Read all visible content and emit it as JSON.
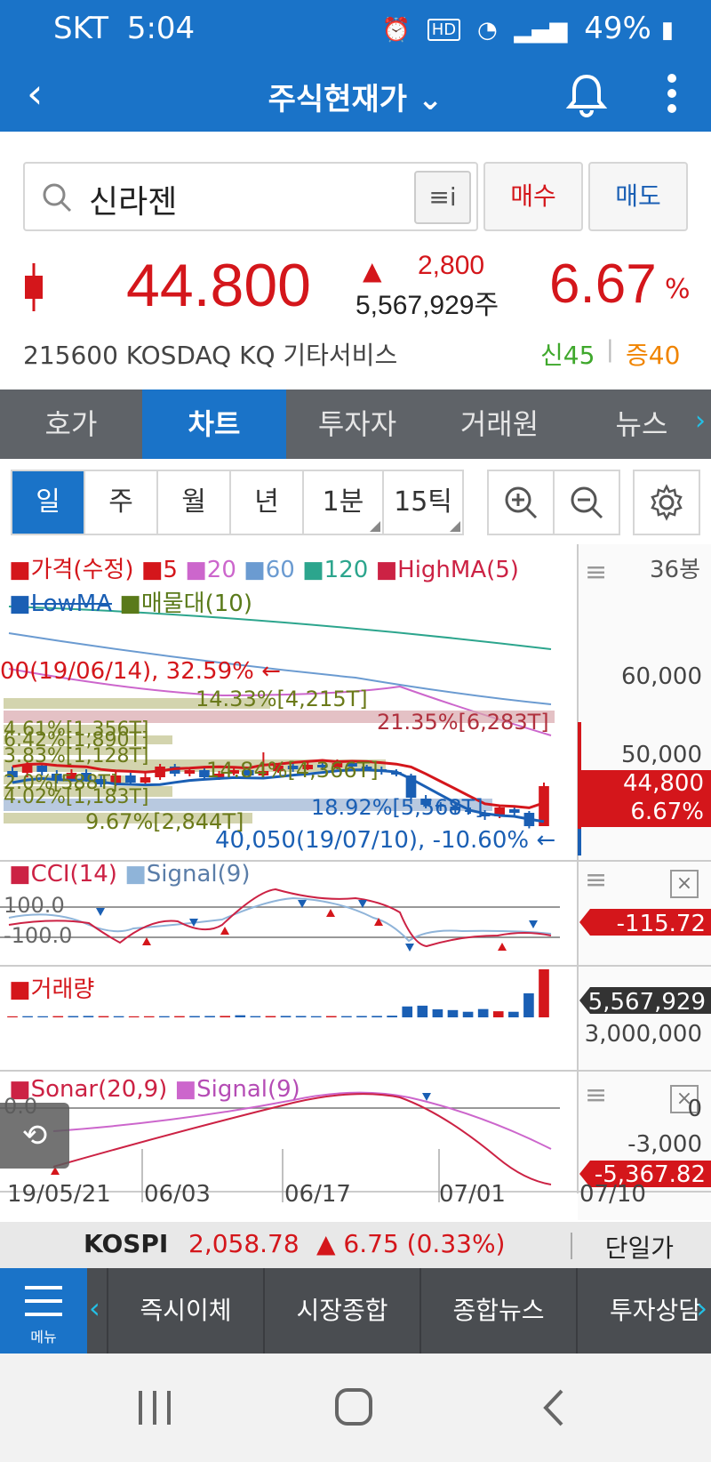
{
  "status": {
    "carrier": "SKT",
    "time": "5:04",
    "battery": "49%",
    "hd_label": "HD"
  },
  "app": {
    "title": "주식현재가 ⌄"
  },
  "search": {
    "value": "신라젠",
    "filter_icon": "≡i"
  },
  "actions": {
    "buy": "매수",
    "sell": "매도"
  },
  "quote": {
    "price": "44.800",
    "change_arrow": "▲",
    "change": "2,800",
    "volume": "5,567,929주",
    "percent": "6.67",
    "percent_sign": "%",
    "code_info": "215600  KOSDAQ  KQ 기타서비스",
    "badge_new": "신45",
    "badge_sep": "|",
    "badge_inc": "증40"
  },
  "tabs": [
    {
      "label": "호가"
    },
    {
      "label": "차트"
    },
    {
      "label": "투자자"
    },
    {
      "label": "거래원"
    },
    {
      "label": "뉴스"
    }
  ],
  "periods": [
    {
      "label": "일"
    },
    {
      "label": "주"
    },
    {
      "label": "월"
    },
    {
      "label": "년"
    },
    {
      "label": "1분"
    },
    {
      "label": "15틱"
    }
  ],
  "chart_legend": {
    "price": "가격(수정)",
    "ma5": "5",
    "ma20": "20",
    "ma60": "60",
    "ma120": "120",
    "highma": "HighMA(5)",
    "lowma": "LowMA",
    "volprofile": "매물대(10)",
    "bars_count": "36봉",
    "cci": "CCI(14)",
    "cci_signal": "Signal(9)",
    "volume": "거래량",
    "sonar": "Sonar(20,9)",
    "sonar_signal": "Signal(9)"
  },
  "chart_annotations": {
    "high_note": "00(19/06/14), 32.59% ←",
    "low_note": "40,050(19/07/10), -10.60% ←",
    "vp": [
      "14.33%[4,215T]",
      "21.35%[6,283T]",
      "4.61%[1,356T]",
      "6.42%[1,890T]",
      "3.83%[1,128T]",
      "14.84%[4,366T]",
      "2.0%[588T]",
      "4.02%[1,183T]",
      "18.92%[5,568T]",
      "9.67%[2,844T]"
    ]
  },
  "axis": {
    "price_ticks": [
      "60,000",
      "50,000"
    ],
    "price_tag": [
      "44,800",
      "6.67%"
    ],
    "cci_ticks": [
      "100.0",
      "-100.0"
    ],
    "cci_tag": "-115.72",
    "vol_tick": "3,000,000",
    "vol_tag": "5,567,929",
    "sonar_ticks": [
      "0.0",
      "0",
      "-3,000"
    ],
    "sonar_tag": "-5,367.82",
    "dates": [
      "19/05/21",
      "06/03",
      "06/17",
      "07/01",
      "07/10"
    ]
  },
  "chart_data": {
    "type": "candlestick",
    "dates_shown": [
      "19/05/21",
      "06/03",
      "06/17",
      "07/01",
      "07/10"
    ],
    "price_ylim": [
      38000,
      66000
    ],
    "last_price": 44800,
    "last_change_pct": 6.67,
    "period_high": {
      "date": "19/06/14",
      "pct": 32.59
    },
    "period_low": {
      "date": "19/07/10",
      "value": 40050,
      "pct": -10.6
    },
    "candles": [
      {
        "o": 46500,
        "c": 45800,
        "h": 47000,
        "l": 45200
      },
      {
        "o": 46300,
        "c": 47200,
        "h": 47500,
        "l": 45800
      },
      {
        "o": 47100,
        "c": 46400,
        "h": 47400,
        "l": 46000
      },
      {
        "o": 46200,
        "c": 45500,
        "h": 46600,
        "l": 45100
      },
      {
        "o": 45600,
        "c": 46300,
        "h": 46700,
        "l": 45300
      },
      {
        "o": 46300,
        "c": 45600,
        "h": 46700,
        "l": 45300
      },
      {
        "o": 45600,
        "c": 45000,
        "h": 46000,
        "l": 44700
      },
      {
        "o": 45000,
        "c": 46000,
        "h": 46600,
        "l": 44800
      },
      {
        "o": 46000,
        "c": 45200,
        "h": 46300,
        "l": 44900
      },
      {
        "o": 45200,
        "c": 45800,
        "h": 46300,
        "l": 45000
      },
      {
        "o": 45800,
        "c": 47000,
        "h": 47300,
        "l": 45500
      },
      {
        "o": 47000,
        "c": 46200,
        "h": 47300,
        "l": 45900
      },
      {
        "o": 46200,
        "c": 46600,
        "h": 46900,
        "l": 45900
      },
      {
        "o": 46600,
        "c": 45800,
        "h": 46900,
        "l": 45500
      },
      {
        "o": 45800,
        "c": 46200,
        "h": 46500,
        "l": 45500
      },
      {
        "o": 46200,
        "c": 46600,
        "h": 47000,
        "l": 46000
      },
      {
        "o": 46600,
        "c": 46000,
        "h": 46900,
        "l": 45700
      },
      {
        "o": 46000,
        "c": 46500,
        "h": 48600,
        "l": 45800
      },
      {
        "o": 46500,
        "c": 47100,
        "h": 47400,
        "l": 46300
      },
      {
        "o": 47100,
        "c": 46700,
        "h": 47400,
        "l": 46400
      },
      {
        "o": 46700,
        "c": 47200,
        "h": 47600,
        "l": 46600
      },
      {
        "o": 47200,
        "c": 46900,
        "h": 47500,
        "l": 46600
      },
      {
        "o": 46900,
        "c": 47400,
        "h": 47800,
        "l": 46700
      },
      {
        "o": 47400,
        "c": 47000,
        "h": 47700,
        "l": 46800
      },
      {
        "o": 47000,
        "c": 46700,
        "h": 47200,
        "l": 46500
      },
      {
        "o": 46700,
        "c": 46400,
        "h": 47000,
        "l": 46100
      },
      {
        "o": 46400,
        "c": 46100,
        "h": 46700,
        "l": 45900
      },
      {
        "o": 46000,
        "c": 43500,
        "h": 46200,
        "l": 42800
      },
      {
        "o": 43400,
        "c": 42700,
        "h": 43800,
        "l": 42300
      },
      {
        "o": 42700,
        "c": 42500,
        "h": 43000,
        "l": 42000
      },
      {
        "o": 42500,
        "c": 42100,
        "h": 42800,
        "l": 41600
      },
      {
        "o": 42100,
        "c": 42000,
        "h": 42400,
        "l": 41700
      },
      {
        "o": 41700,
        "c": 41400,
        "h": 42100,
        "l": 41000
      },
      {
        "o": 41400,
        "c": 42400,
        "h": 42700,
        "l": 41200
      },
      {
        "o": 42200,
        "c": 41800,
        "h": 42600,
        "l": 41500
      },
      {
        "o": 41800,
        "c": 40300,
        "h": 42000,
        "l": 40050
      },
      {
        "o": 40300,
        "c": 44800,
        "h": 45200,
        "l": 40300
      }
    ],
    "volume": [
      80,
      90,
      85,
      95,
      100,
      110,
      95,
      90,
      80,
      85,
      90,
      95,
      100,
      105,
      110,
      160,
      95,
      100,
      110,
      105,
      90,
      100,
      95,
      105,
      110,
      130,
      840,
      900,
      620,
      560,
      430,
      640,
      470,
      430,
      1850,
      3700
    ],
    "volume_ylim": [
      0,
      6000000
    ],
    "cci_ylim": [
      -250,
      250
    ],
    "sonar_ylim": [
      -6000,
      1500
    ]
  },
  "index_bar": {
    "name": "KOSPI",
    "value": "2,058.78",
    "change": "▲ 6.75 (0.33%)",
    "unit": "단일가"
  },
  "bottom_nav": {
    "menu": "메뉴",
    "items": [
      {
        "label": "즉시이체"
      },
      {
        "label": "시장종합"
      },
      {
        "label": "종합뉴스"
      },
      {
        "label": "투자상담"
      }
    ]
  },
  "colors": {
    "brand": "#1a73c8",
    "up": "#d4161b",
    "down": "#1a5fb4"
  }
}
